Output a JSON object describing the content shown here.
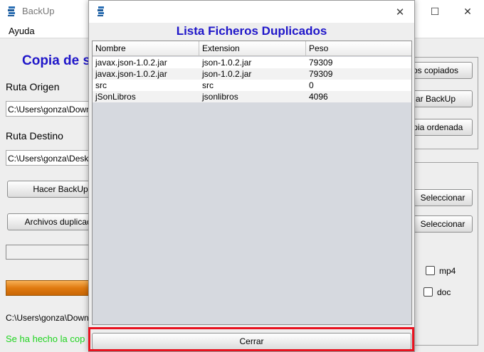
{
  "main_window": {
    "title": "BackUp",
    "controls": {
      "minimize": "—",
      "maximize": "☐",
      "close": "✕"
    },
    "menu": [
      "Ayuda"
    ],
    "heading": "Copia de se",
    "ruta_origen_label": "Ruta Origen",
    "ruta_origen_value": "C:\\Users\\gonza\\Downl",
    "ruta_destino_label": "Ruta Destino",
    "ruta_destino_value": "C:\\Users\\gonza\\Deskt",
    "hacer_backup_button": "Hacer BackUp",
    "archivos_duplicados_button": "Archivos duplicado",
    "right_buttons": [
      "os copiados",
      "ar BackUp",
      "opia ordenada"
    ],
    "seleccionar_buttons": [
      "Seleccionar",
      "Seleccionar"
    ],
    "checkboxes": [
      {
        "label": "mp4",
        "checked": false
      },
      {
        "label": "doc",
        "checked": false
      }
    ],
    "progress_bar_fill": 1.0,
    "bottom_path": "C:\\Users\\gonza\\Downl",
    "status_text": "Se ha hecho la cop",
    "accent_color": "#1f16c9",
    "status_color": "#1ed41e"
  },
  "dialog": {
    "title_icon": "app-icon",
    "close_symbol": "✕",
    "heading": "Lista Ficheros Duplicados",
    "columns": [
      "Nombre",
      "Extension",
      "Peso"
    ],
    "rows": [
      [
        "javax.json-1.0.2.jar",
        "json-1.0.2.jar",
        "79309"
      ],
      [
        "javax.json-1.0.2.jar",
        "json-1.0.2.jar",
        "79309"
      ],
      [
        "src",
        "src",
        "0"
      ],
      [
        "jSonLibros",
        "jsonlibros",
        "4096"
      ]
    ],
    "cerrar_button": "Cerrar",
    "highlight_color": "#e8121f"
  }
}
